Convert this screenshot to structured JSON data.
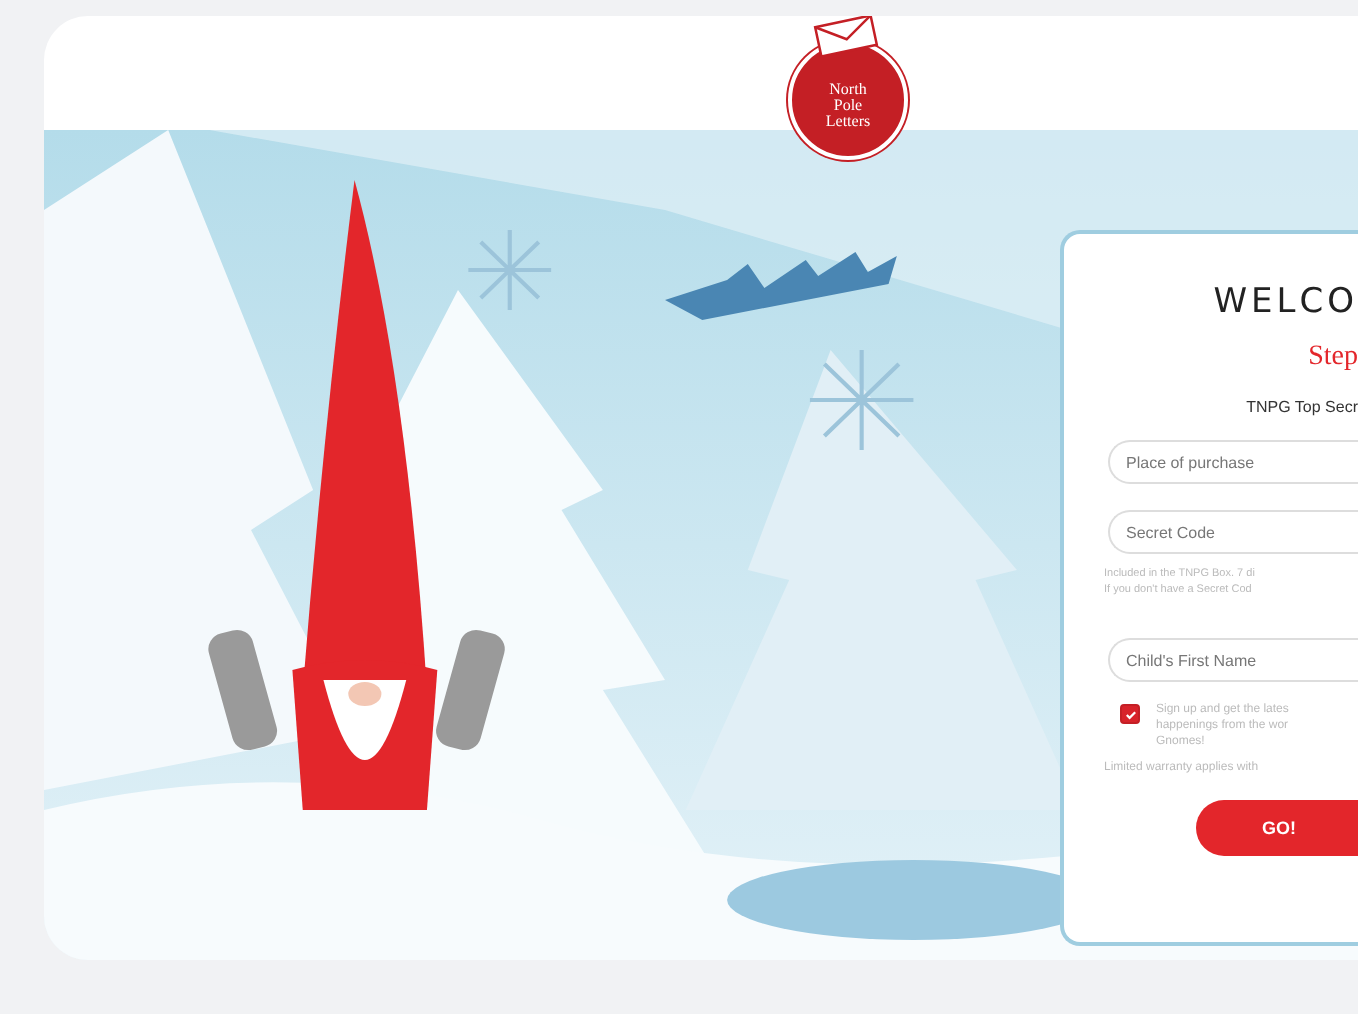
{
  "logo": {
    "text": "North Pole Letters"
  },
  "form": {
    "title": "WELCO",
    "step": "Step",
    "subtitle": "TNPG Top Secr",
    "fields": [
      {
        "placeholder": "Place of purchase"
      },
      {
        "placeholder": "Secret Code"
      }
    ],
    "hint_lines": [
      "Included in the TNPG Box. 7 di",
      "If you don't have a Secret Cod"
    ],
    "name_field": {
      "placeholder": "Child's First Name"
    },
    "signup": {
      "checked": true,
      "lines": [
        "Sign up and get the lates",
        "happenings from the wor",
        "Gnomes!"
      ]
    },
    "note": "Limited warranty applies with",
    "button": "GO!"
  }
}
